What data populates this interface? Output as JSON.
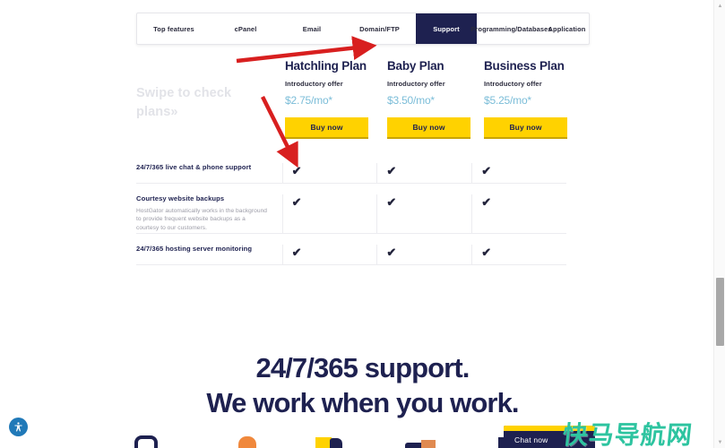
{
  "tabs": [
    {
      "label": "Top features",
      "active": false
    },
    {
      "label": "cPanel",
      "active": false
    },
    {
      "label": "Email",
      "active": false
    },
    {
      "label": "Domain/FTP",
      "active": false
    },
    {
      "label": "Support",
      "active": true
    },
    {
      "label": "Programming/Databases",
      "active": false
    },
    {
      "label": "Application",
      "active": false
    }
  ],
  "swipe_hint": "Swipe to check plans»",
  "plans": [
    {
      "name": "Hatchling Plan",
      "offer_label": "Introductory offer",
      "price": "$2.75/mo*",
      "cta": "Buy now"
    },
    {
      "name": "Baby Plan",
      "offer_label": "Introductory offer",
      "price": "$3.50/mo*",
      "cta": "Buy now"
    },
    {
      "name": "Business Plan",
      "offer_label": "Introductory offer",
      "price": "$5.25/mo*",
      "cta": "Buy now"
    }
  ],
  "features": [
    {
      "name": "24/7/365 live chat & phone support",
      "description": "",
      "values": [
        "✔",
        "✔",
        "✔"
      ]
    },
    {
      "name": "Courtesy website backups",
      "description": "HostGator automatically works in the background to provide frequent website backups as a courtesy to our customers.",
      "values": [
        "✔",
        "✔",
        "✔"
      ]
    },
    {
      "name": "24/7/365 hosting server monitoring",
      "description": "",
      "values": [
        "✔",
        "✔",
        "✔"
      ]
    }
  ],
  "heading": {
    "line1": "24/7/365 support.",
    "line2": "We work when you work."
  },
  "chat": {
    "label": "Chat now"
  },
  "watermark": {
    "text": "快马导航网"
  },
  "accessibility": {
    "label": "Accessibility"
  },
  "scrollbar": {
    "up": "▲",
    "down": "▼"
  },
  "colors": {
    "navy": "#1e2150",
    "yellow": "#ffd200",
    "price_blue": "#7bbdd8",
    "annotation_red": "#d81f1f",
    "watermark_teal": "#2ec4a0",
    "a11y_blue": "#2079b8"
  }
}
